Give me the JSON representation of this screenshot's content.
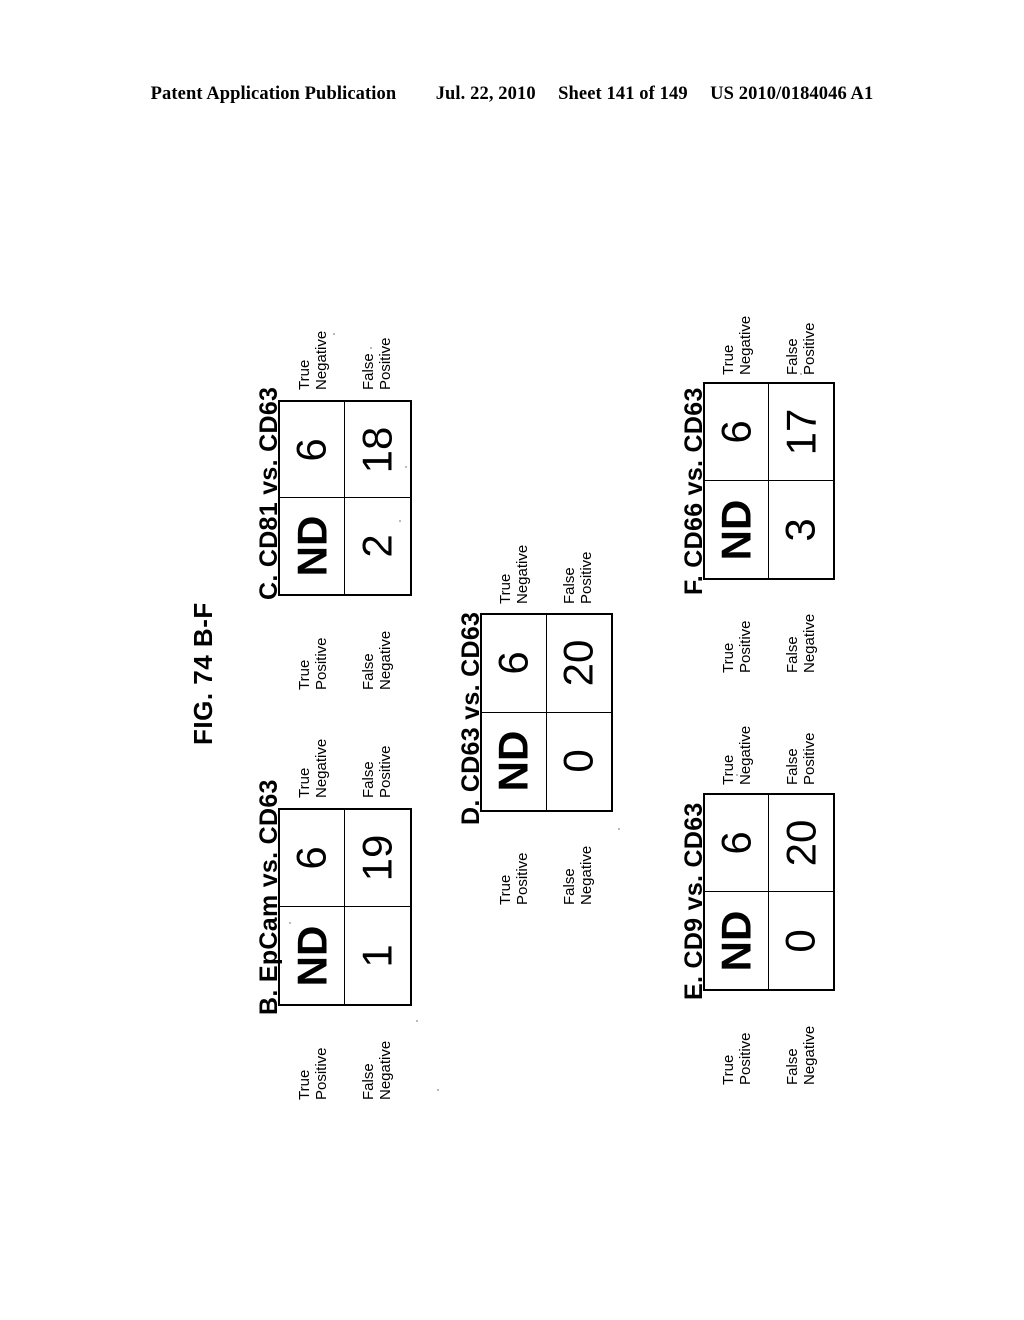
{
  "header": {
    "publication": "Patent Application Publication",
    "date": "Jul. 22, 2010",
    "sheet": "Sheet 141 of 149",
    "patent_number": "US 2010/0184046 A1"
  },
  "figure": {
    "title": "FIG. 74 B-F",
    "axis_labels": {
      "true_positive_line1": "True",
      "true_positive_line2": "Positive",
      "false_negative_line1": "False",
      "false_negative_line2": "Negative",
      "true_negative_line1": "True",
      "true_negative_line2": "Negative",
      "false_positive_line1": "False",
      "false_positive_line2": "Positive"
    },
    "panels": [
      {
        "id": "B",
        "title": "B.  EpCam vs. CD63",
        "true_positive": "19",
        "true_negative": "6",
        "false_negative": "1",
        "false_positive": "ND"
      },
      {
        "id": "C",
        "title": "C.  CD81 vs. CD63",
        "true_positive": "18",
        "true_negative": "6",
        "false_negative": "2",
        "false_positive": "ND"
      },
      {
        "id": "D",
        "title": "D.  CD63 vs. CD63",
        "true_positive": "20",
        "true_negative": "6",
        "false_negative": "0",
        "false_positive": "ND"
      },
      {
        "id": "E",
        "title": "E.  CD9 vs. CD63",
        "true_positive": "20",
        "true_negative": "6",
        "false_negative": "0",
        "false_positive": "ND"
      },
      {
        "id": "F",
        "title": "F.  CD66 vs. CD63",
        "true_positive": "17",
        "true_negative": "6",
        "false_negative": "3",
        "false_positive": "ND"
      }
    ]
  }
}
